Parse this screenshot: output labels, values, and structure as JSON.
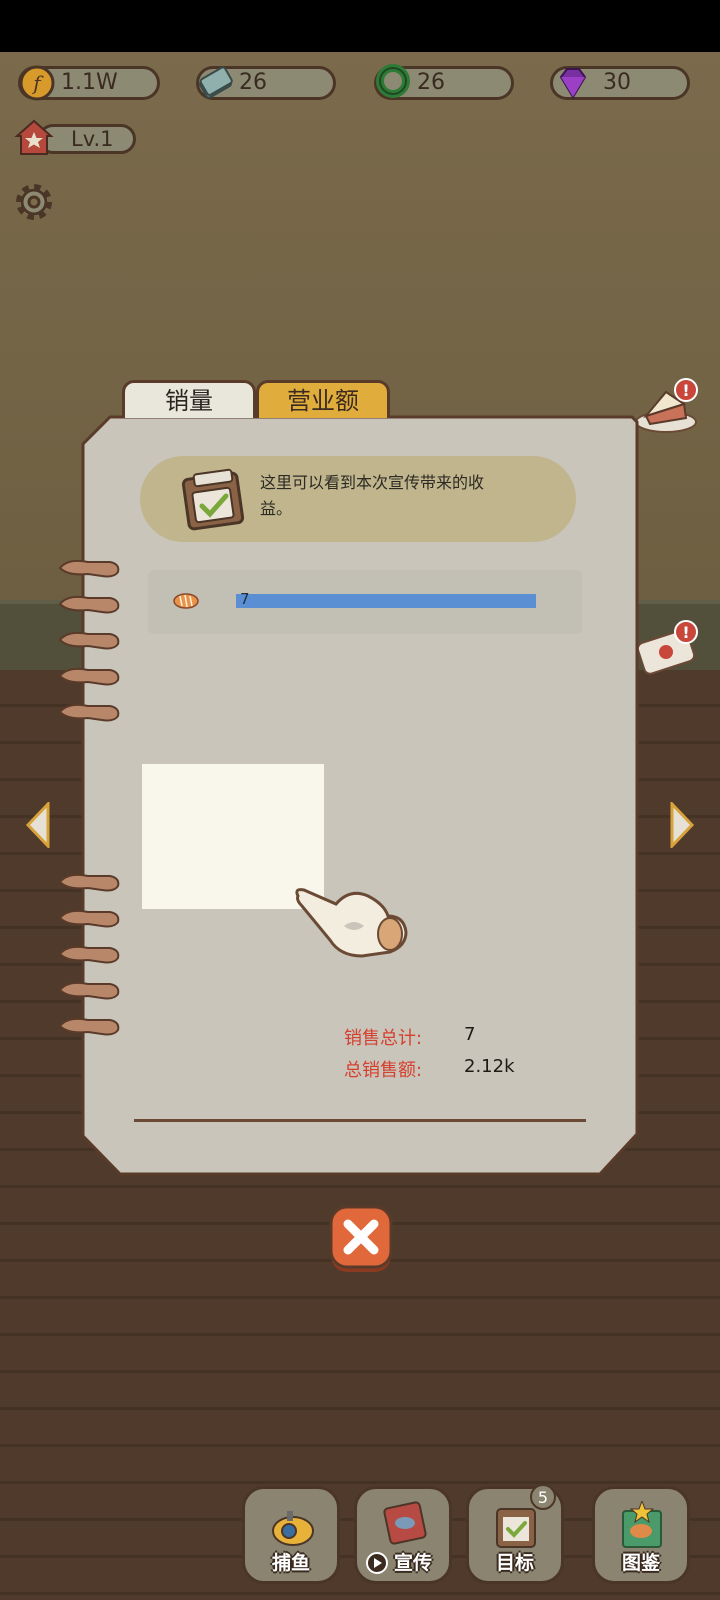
{
  "currencies": [
    {
      "name": "coin",
      "value": "1.1W",
      "icon": "coin-icon"
    },
    {
      "name": "cash",
      "value": "26",
      "icon": "banknote-icon"
    },
    {
      "name": "bait",
      "value": "26",
      "icon": "green-ring-icon"
    },
    {
      "name": "gem",
      "value": "30",
      "icon": "purple-gem-icon"
    }
  ],
  "level": {
    "label": "Lv.1"
  },
  "tabs": [
    {
      "label": "销量",
      "active": true
    },
    {
      "label": "营业额",
      "active": false
    }
  ],
  "tip": {
    "text": "这里可以看到本次宣传带来的收益。"
  },
  "sales_row": {
    "item_icon": "fish-fillet-icon",
    "value": "7",
    "bar_fill": 1.0
  },
  "summary": {
    "total_sales_label": "销售总计:",
    "total_sales_value": "7",
    "total_revenue_label": "总销售额:",
    "total_revenue_value": "2.12k"
  },
  "nav": [
    {
      "label": "捕鱼",
      "icon": "submarine-icon"
    },
    {
      "label": "宣传",
      "icon": "promo-play-icon"
    },
    {
      "label": "目标",
      "icon": "goal-clipboard-icon",
      "badge": "5"
    },
    {
      "label": "图鉴",
      "icon": "fish-album-icon"
    }
  ],
  "colors": {
    "accent_tab": "#e0ad3c",
    "bar": "#5a8fd4",
    "label_red": "#d6402f"
  }
}
